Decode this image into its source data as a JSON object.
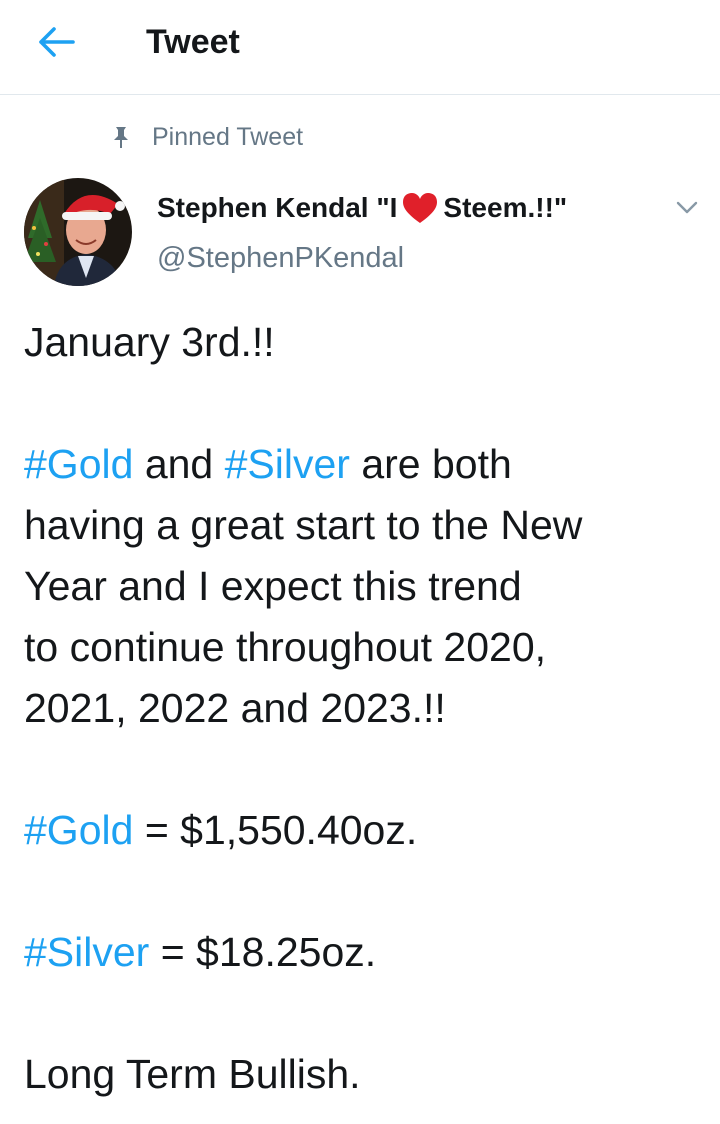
{
  "header": {
    "title": "Tweet",
    "back_icon": "arrow-left-icon",
    "accent_color": "#1da1f2"
  },
  "pinned": {
    "icon": "pin-icon",
    "label": "Pinned Tweet"
  },
  "author": {
    "name_before_heart": "Stephen Kendal \"I",
    "heart_icon": "heart-icon",
    "name_after_heart": "Steem.!!\"",
    "handle": "@StephenPKendal",
    "menu_icon": "chevron-down-icon"
  },
  "tweet": {
    "line1": "January 3rd.!!",
    "para2": {
      "tag_gold": "#Gold",
      "word_and": " and ",
      "tag_silver": "#Silver",
      "rest_line1": " are both",
      "line2": "having a great start to the New",
      "line3": "Year and I expect this trend",
      "line4": "to continue throughout 2020,",
      "line5": "2021, 2022 and 2023.!!"
    },
    "gold_line": {
      "tag": "#Gold",
      "text": " = $1,550.40oz."
    },
    "silver_line": {
      "tag": "#Silver",
      "text": " = $18.25oz."
    },
    "closing": "Long Term Bullish."
  }
}
